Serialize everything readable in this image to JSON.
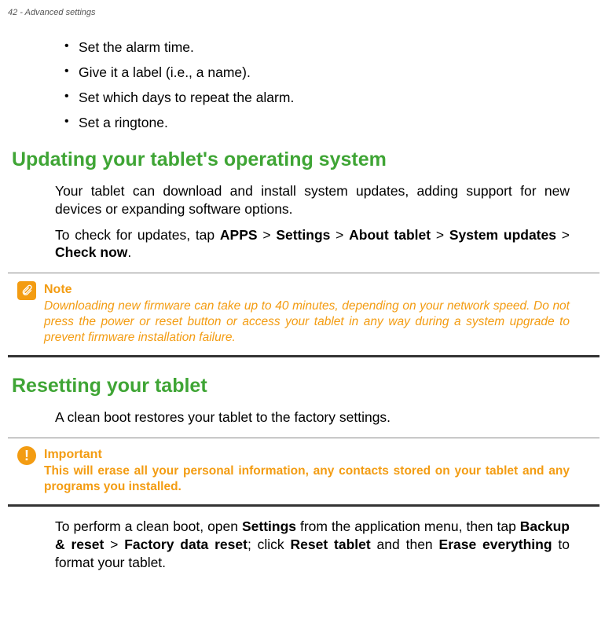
{
  "header": {
    "pageInfo": "42 - Advanced settings"
  },
  "bullets": [
    "Set the alarm time.",
    "Give it a label (i.e., a name).",
    "Set which days to repeat the alarm.",
    "Set a ringtone."
  ],
  "section1": {
    "heading": "Updating your tablet's operating system",
    "para1": "Your tablet can download and install system updates, adding support for new devices or expanding software options.",
    "para2_prefix": "To check for updates, tap ",
    "para2_b1": "APPS",
    "para2_s1": " > ",
    "para2_b2": "Settings",
    "para2_s2": " > ",
    "para2_b3": "About tablet",
    "para2_s3": " > ",
    "para2_b4": "System updates",
    "para2_s4": " > ",
    "para2_b5": "Check now",
    "para2_suffix": "."
  },
  "noteBox": {
    "title": "Note",
    "body": "Downloading new firmware can take up to 40 minutes, depending on your network speed. Do not press the power or reset button or access your tablet in any way during a system upgrade to prevent firmware installation failure."
  },
  "section2": {
    "heading": "Resetting your tablet",
    "para1": "A clean boot restores your tablet to the factory settings."
  },
  "importantBox": {
    "title": "Important",
    "body": "This will erase all your personal information, any contacts stored on your tablet and any programs you installed."
  },
  "section2b": {
    "prefix": "To perform a clean boot, open ",
    "b1": "Settings",
    "s1": " from the application menu, then tap ",
    "b2": "Backup & reset",
    "s2": " > ",
    "b3": "Factory data reset",
    "s3": "; click ",
    "b4": "Reset tablet",
    "s4": " and then ",
    "b5": "Erase everything",
    "suffix": " to format your tablet."
  }
}
